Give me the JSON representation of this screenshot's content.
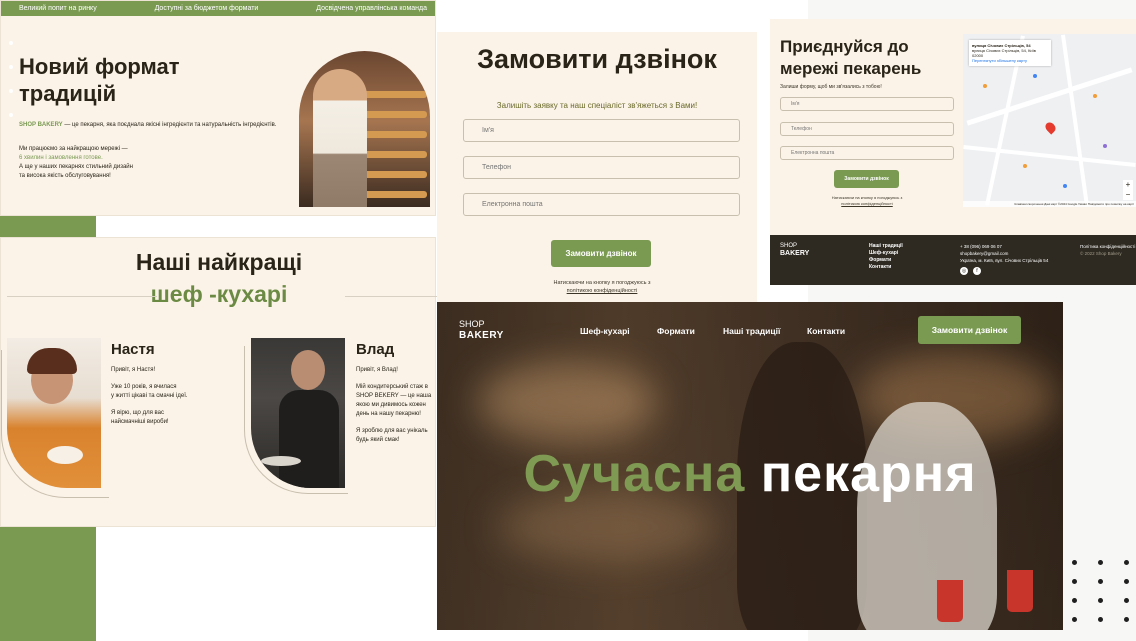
{
  "panel_tradition": {
    "topbar": [
      "Великий попит на ринку",
      "Доступні за бюджетом формати",
      "Досвідчена управлінська команда"
    ],
    "title": "Новий формат традицій",
    "brand": "SHOP BAKERY",
    "desc": "— це пекарня, яка поєднала якісні інгредієнти та натуральність інгредієнтів.",
    "desc2_line1": "Ми працюємо за найкращою мережі —",
    "desc2_line2": "6 хвилин і замовлення готове.",
    "desc2_line3": "А ще у наших пекарнях стильний дизайн",
    "desc2_line4": "та висока якість обслуговування!"
  },
  "panel_chefs": {
    "title_line1": "Наші найкращі",
    "title_line2": "шеф -кухарі",
    "chefs": [
      {
        "name": "Настя",
        "greeting": "Привіт, я Настя!",
        "p1": "Уже 10 років, я вчилася",
        "p1b": "у житті цікаві та смачні ідеї.",
        "p2": "Я вірю, що для вас",
        "p2b": "найсмачніші вироби!"
      },
      {
        "name": "Влад",
        "greeting": "Привіт, я Влад!",
        "p1": "Мій кондитерський стаж в",
        "p1b": "SHOP BEKERY — це наша",
        "p1c": "якою ми дивимось кожен",
        "p1d": "день на нашу пекарню!",
        "p2": "Я зроблю для вас унікаль",
        "p2b": "будь який смак!"
      }
    ]
  },
  "panel_order": {
    "title": "Замовити дзвінок",
    "subtitle": "Залишіть заявку та наш спеціаліст зв'яжеться з Вами!",
    "name_placeholder": "Ім'я",
    "phone_placeholder": "Телефон",
    "email_placeholder": "Електронна пошта",
    "button": "Замовити дзвінок",
    "fine_line1": "Натискаючи на кнопку я погоджуюсь з",
    "fine_link": "політикою конфіденційності"
  },
  "panel_network": {
    "title": "Приєднуйся до мережі пекарень",
    "subtitle": "Залиши форму, щоб ми зв'язались з тобою!",
    "name_placeholder": "Ім'я",
    "phone_placeholder": "Телефон",
    "email_placeholder": "Електронна пошта",
    "button": "Замовити дзвінок",
    "fine_line1": "Натискаючи на кнопку я погоджуюсь з",
    "fine_link": "політикою конфіденційності",
    "map_card_line1": "вулиця Січових Стрільців, 54",
    "map_card_line2": "вулиця Січових Стрільців, 54, Київ",
    "map_card_line3": "02000",
    "map_card_link": "Переглянути збільшену карту",
    "map_attrib": "Клавішні скорочення   Дані карт ©2024 Google   Умови   Повідомити про помилку на карті",
    "footer": {
      "logo_top": "SHOP",
      "logo_bottom": "BAKERY",
      "nav": [
        "Наші традиції",
        "Шеф-кухарі",
        "Формати",
        "Контакти"
      ],
      "phone": "+ 38 (096) 069 06 07",
      "email": "shopbakery@gmail.com",
      "address": "Україна, м. Київ, вул. Січових Стрільців 54",
      "policy": "Політика конфіденційності",
      "copyright": "© 2022 Shop Bakery"
    }
  },
  "panel_hero": {
    "logo_top": "SHOP",
    "logo_bottom": "BAKERY",
    "nav": [
      "Шеф-кухарі",
      "Формати",
      "Наші традиції",
      "Контакти"
    ],
    "button": "Замовити дзвінок",
    "title_green": "Сучасна",
    "title_white": "пекарня"
  },
  "colors": {
    "accent": "#7a9a52",
    "dark": "#2e2a21",
    "cream": "#fbf3e8"
  }
}
